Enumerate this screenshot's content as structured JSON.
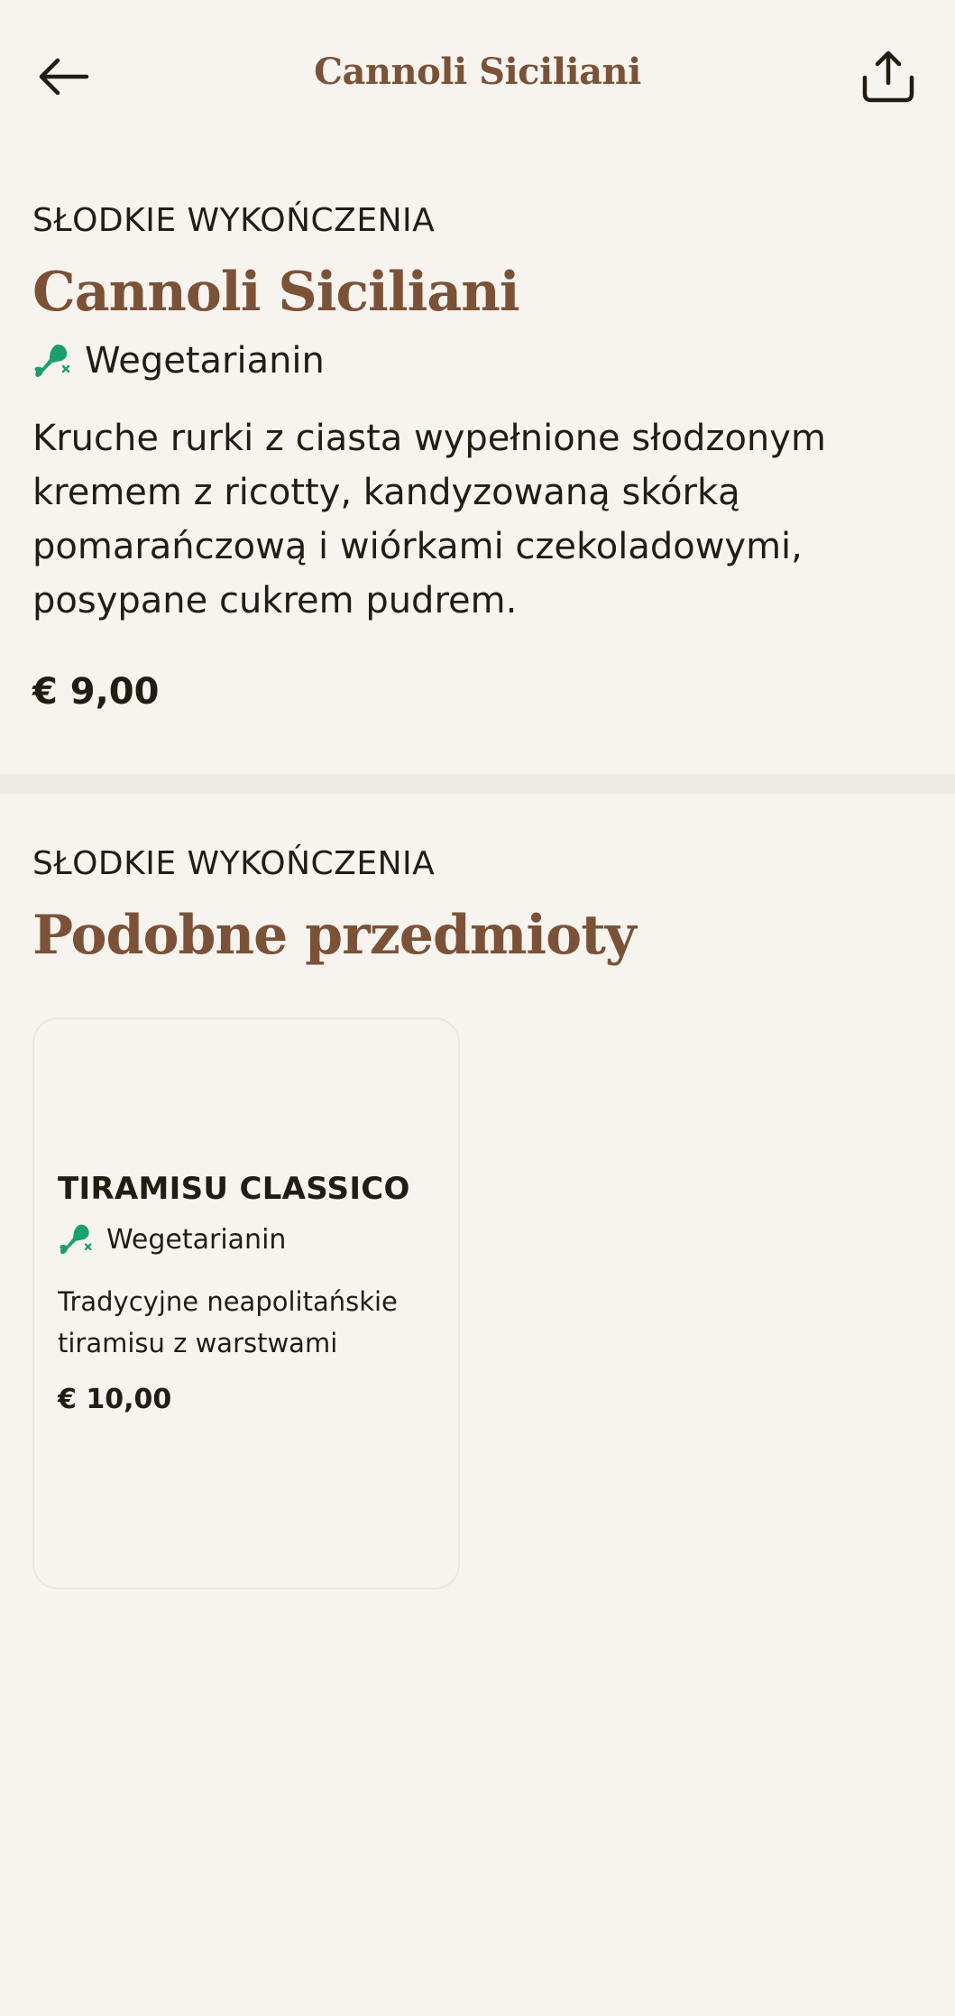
{
  "header": {
    "title": "Cannoli Siciliani"
  },
  "item": {
    "category": "SŁODKIE WYKOŃCZENIA",
    "name": "Cannoli Siciliani",
    "diet_label": "Wegetarianin",
    "description": "Kruche rurki z ciasta wypełnione słodzonym kremem z ricotty, kandyzowaną skórką pomarańczową i wiórkami czekoladowymi, posypane cukrem pudrem.",
    "price": "€ 9,00"
  },
  "similar": {
    "category": "SŁODKIE WYKOŃCZENIA",
    "title": "Podobne przedmioty",
    "items": [
      {
        "name": "TIRAMISU CLASSICO",
        "diet_label": "Wegetarianin",
        "description": "Tradycyjne neapolitańskie tiramisu z warstwami krem...",
        "price": "€ 10,00"
      }
    ]
  },
  "colors": {
    "background": "#f7f4ef",
    "accent_brown": "#7b5238",
    "text_dark": "#221c12",
    "veg_green": "#1aa06b",
    "divider": "#efebe4"
  },
  "icons": {
    "back": "arrow-left-icon",
    "share": "share-icon",
    "vegetarian": "vegetarian-leg-icon"
  }
}
